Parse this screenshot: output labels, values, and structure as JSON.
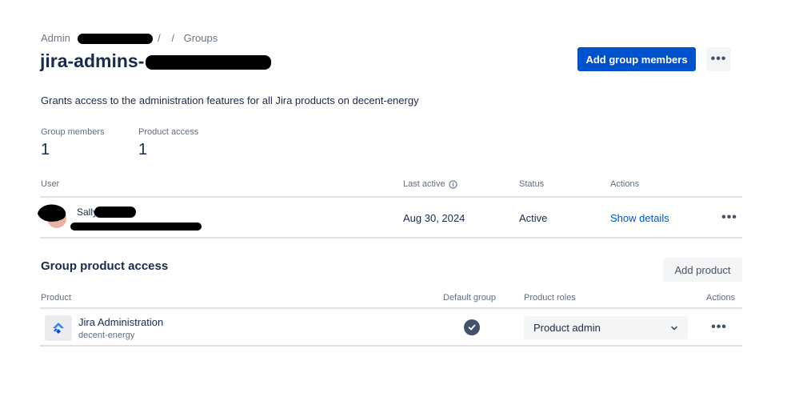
{
  "breadcrumb": {
    "admin": "Admin",
    "sep1": "/",
    "sep2": "/",
    "groups": "Groups"
  },
  "page": {
    "title": "jira-admins-",
    "description": "Grants access to the administration features for all Jira products on decent-energy",
    "add_members_label": "Add group members"
  },
  "stats": {
    "members_label": "Group members",
    "members_value": "1",
    "product_label": "Product access",
    "product_value": "1"
  },
  "users_table": {
    "headers": {
      "user": "User",
      "last_active": "Last active",
      "status": "Status",
      "actions": "Actions"
    },
    "rows": [
      {
        "name": "Sally",
        "last_active": "Aug 30, 2024",
        "status": "Active",
        "action": "Show details"
      }
    ]
  },
  "product_access": {
    "heading": "Group product access",
    "add_product_label": "Add product",
    "headers": {
      "product": "Product",
      "default_group": "Default group",
      "roles": "Product roles",
      "actions": "Actions"
    },
    "rows": [
      {
        "name": "Jira Administration",
        "site": "decent-energy",
        "role": "Product admin"
      }
    ]
  },
  "colors": {
    "primary": "#0052cc",
    "text": "#172b4d",
    "muted": "#5e6c84",
    "divider": "#dfe1e6"
  }
}
